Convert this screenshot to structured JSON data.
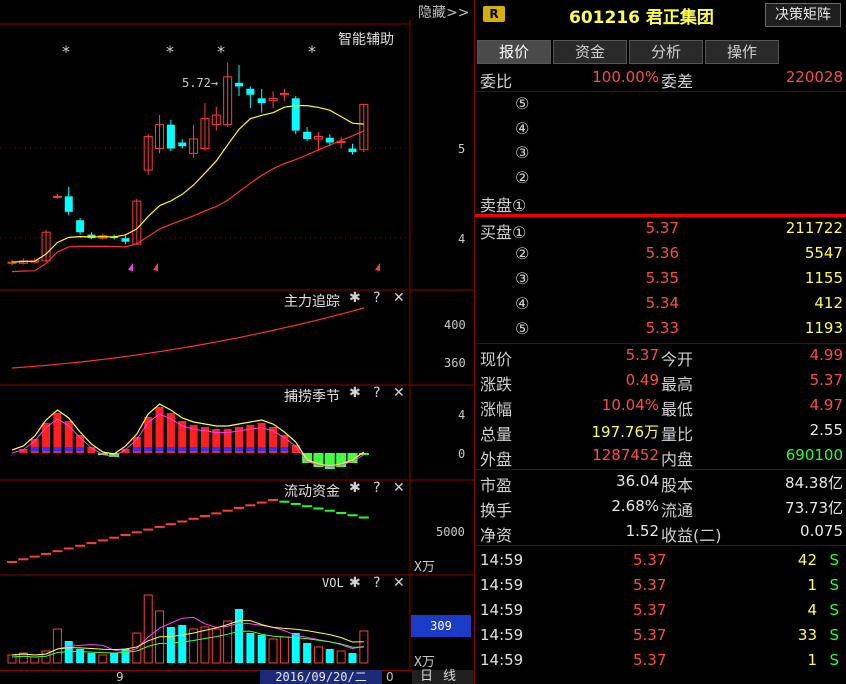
{
  "chart": {
    "hide_label": "隐藏>>",
    "smart_assist": "智能辅助",
    "price_annotation": "5.72→",
    "price_axis": [
      "5",
      "4"
    ],
    "panels": {
      "main_force": {
        "title": "主力追踪",
        "axis": [
          "400",
          "360"
        ]
      },
      "bottom_fish": {
        "title": "捕捞季节",
        "axis": [
          "4",
          "0"
        ]
      },
      "liquid_funds": {
        "title": "流动资金",
        "axis": [
          "5000"
        ],
        "unit": "X万"
      },
      "vol": {
        "title": "VOL",
        "axis": [
          "309"
        ],
        "unit": "X万"
      }
    },
    "tool_icons": "✱ ? ✕",
    "bottom_tick": "9",
    "bottom_date": "2016/09/20/二",
    "bottom_zero": "0",
    "bottom_period": "日线",
    "colors": {
      "up": "#ff3c3c",
      "down": "#00ffff",
      "ma5": "#ffffff",
      "ma10": "#ffff00",
      "ma20": "#ff3030"
    }
  },
  "candles": [
    {
      "o": 4.04,
      "c": 4.05,
      "h": 4.07,
      "l": 4.02
    },
    {
      "o": 4.04,
      "c": 4.06,
      "h": 4.08,
      "l": 4.03
    },
    {
      "o": 4.05,
      "c": 4.06,
      "h": 4.08,
      "l": 4.04
    },
    {
      "o": 4.06,
      "c": 4.3,
      "h": 4.32,
      "l": 4.05
    },
    {
      "o": 4.6,
      "c": 4.6,
      "h": 4.62,
      "l": 4.58
    },
    {
      "o": 4.6,
      "c": 4.47,
      "h": 4.68,
      "l": 4.44
    },
    {
      "o": 4.4,
      "c": 4.3,
      "h": 4.42,
      "l": 4.28
    },
    {
      "o": 4.28,
      "c": 4.25,
      "h": 4.3,
      "l": 4.24
    },
    {
      "o": 4.25,
      "c": 4.27,
      "h": 4.29,
      "l": 4.24
    },
    {
      "o": 4.26,
      "c": 4.25,
      "h": 4.28,
      "l": 4.24
    },
    {
      "o": 4.25,
      "c": 4.22,
      "h": 4.27,
      "l": 4.2
    },
    {
      "o": 4.2,
      "c": 4.56,
      "h": 4.58,
      "l": 4.2
    },
    {
      "o": 4.82,
      "c": 5.1,
      "h": 5.12,
      "l": 4.78
    },
    {
      "o": 5,
      "c": 5.2,
      "h": 5.28,
      "l": 4.96
    },
    {
      "o": 5.2,
      "c": 5.0,
      "h": 5.24,
      "l": 4.98
    },
    {
      "o": 5.05,
      "c": 5.02,
      "h": 5.08,
      "l": 5.0
    },
    {
      "o": 4.96,
      "c": 5.08,
      "h": 5.2,
      "l": 4.92
    },
    {
      "o": 5,
      "c": 5.25,
      "h": 5.38,
      "l": 4.98
    },
    {
      "o": 5.2,
      "c": 5.28,
      "h": 5.35,
      "l": 5.15
    },
    {
      "o": 5.2,
      "c": 5.6,
      "h": 5.72,
      "l": 5.18
    },
    {
      "o": 5.55,
      "c": 5.52,
      "h": 5.7,
      "l": 5.44
    },
    {
      "o": 5.5,
      "c": 5.45,
      "h": 5.52,
      "l": 5.34
    },
    {
      "o": 5.42,
      "c": 5.38,
      "h": 5.5,
      "l": 5.3
    },
    {
      "o": 5.4,
      "c": 5.42,
      "h": 5.48,
      "l": 5.34
    },
    {
      "o": 5.45,
      "c": 5.46,
      "h": 5.5,
      "l": 5.4
    },
    {
      "o": 5.42,
      "c": 5.15,
      "h": 5.44,
      "l": 5.12
    },
    {
      "o": 5.14,
      "c": 5.08,
      "h": 5.18,
      "l": 5.06
    },
    {
      "o": 5.08,
      "c": 5.1,
      "h": 5.14,
      "l": 4.98
    },
    {
      "o": 5.09,
      "c": 5.05,
      "h": 5.12,
      "l": 5.02
    },
    {
      "o": 5.05,
      "c": 5.06,
      "h": 5.1,
      "l": 5.0
    },
    {
      "o": 5.0,
      "c": 4.97,
      "h": 5.04,
      "l": 4.95
    },
    {
      "o": 4.99,
      "c": 5.37,
      "h": 5.37,
      "l": 4.97
    }
  ],
  "stock": {
    "badge": "R",
    "code": "601216",
    "name": "君正集团",
    "decision_button": "决策矩阵",
    "tabs": [
      "报价",
      "资金",
      "分析",
      "操作"
    ]
  },
  "quote": {
    "weibi_label": "委比",
    "weibi": "100.00%",
    "weicha_label": "委差",
    "weicha": "220028",
    "sell": [
      {
        "label": "⑤",
        "price": "",
        "vol": ""
      },
      {
        "label": "④",
        "price": "",
        "vol": ""
      },
      {
        "label": "③",
        "price": "",
        "vol": ""
      },
      {
        "label": "②",
        "price": "",
        "vol": ""
      },
      {
        "label": "卖盘①",
        "price": "",
        "vol": ""
      }
    ],
    "buy": [
      {
        "label": "买盘①",
        "price": "5.37",
        "vol": "211722"
      },
      {
        "label": "②",
        "price": "5.36",
        "vol": "5547"
      },
      {
        "label": "③",
        "price": "5.35",
        "vol": "1155"
      },
      {
        "label": "④",
        "price": "5.34",
        "vol": "412"
      },
      {
        "label": "⑤",
        "price": "5.33",
        "vol": "1193"
      }
    ],
    "stats": [
      {
        "l1": "现价",
        "v1": "5.37",
        "c1": "red",
        "l2": "今开",
        "v2": "4.99",
        "c2": "red"
      },
      {
        "l1": "涨跌",
        "v1": "0.49",
        "c1": "red",
        "l2": "最高",
        "v2": "5.37",
        "c2": "red"
      },
      {
        "l1": "涨幅",
        "v1": "10.04%",
        "c1": "red",
        "l2": "最低",
        "v2": "4.97",
        "c2": "red"
      },
      {
        "l1": "总量",
        "v1": "197.76万",
        "c1": "yellow",
        "l2": "量比",
        "v2": "2.55",
        "c2": "white"
      },
      {
        "l1": "外盘",
        "v1": "1287452",
        "c1": "red",
        "l2": "内盘",
        "v2": "690100",
        "c2": "green"
      }
    ],
    "fund": [
      {
        "l1": "市盈",
        "v1": "36.04",
        "l2": "股本",
        "v2": "84.38亿"
      },
      {
        "l1": "换手",
        "v1": "2.68%",
        "l2": "流通",
        "v2": "73.73亿"
      },
      {
        "l1": "净资",
        "v1": "1.52",
        "l2": "收益(二)",
        "v2": "0.075"
      }
    ],
    "ticks": [
      {
        "time": "14:59",
        "price": "5.37",
        "qty": "42",
        "side": "S"
      },
      {
        "time": "14:59",
        "price": "5.37",
        "qty": "1",
        "side": "S"
      },
      {
        "time": "14:59",
        "price": "5.37",
        "qty": "4",
        "side": "S"
      },
      {
        "time": "14:59",
        "price": "5.37",
        "qty": "33",
        "side": "S"
      },
      {
        "time": "14:59",
        "price": "5.37",
        "qty": "1",
        "side": "S"
      }
    ]
  }
}
